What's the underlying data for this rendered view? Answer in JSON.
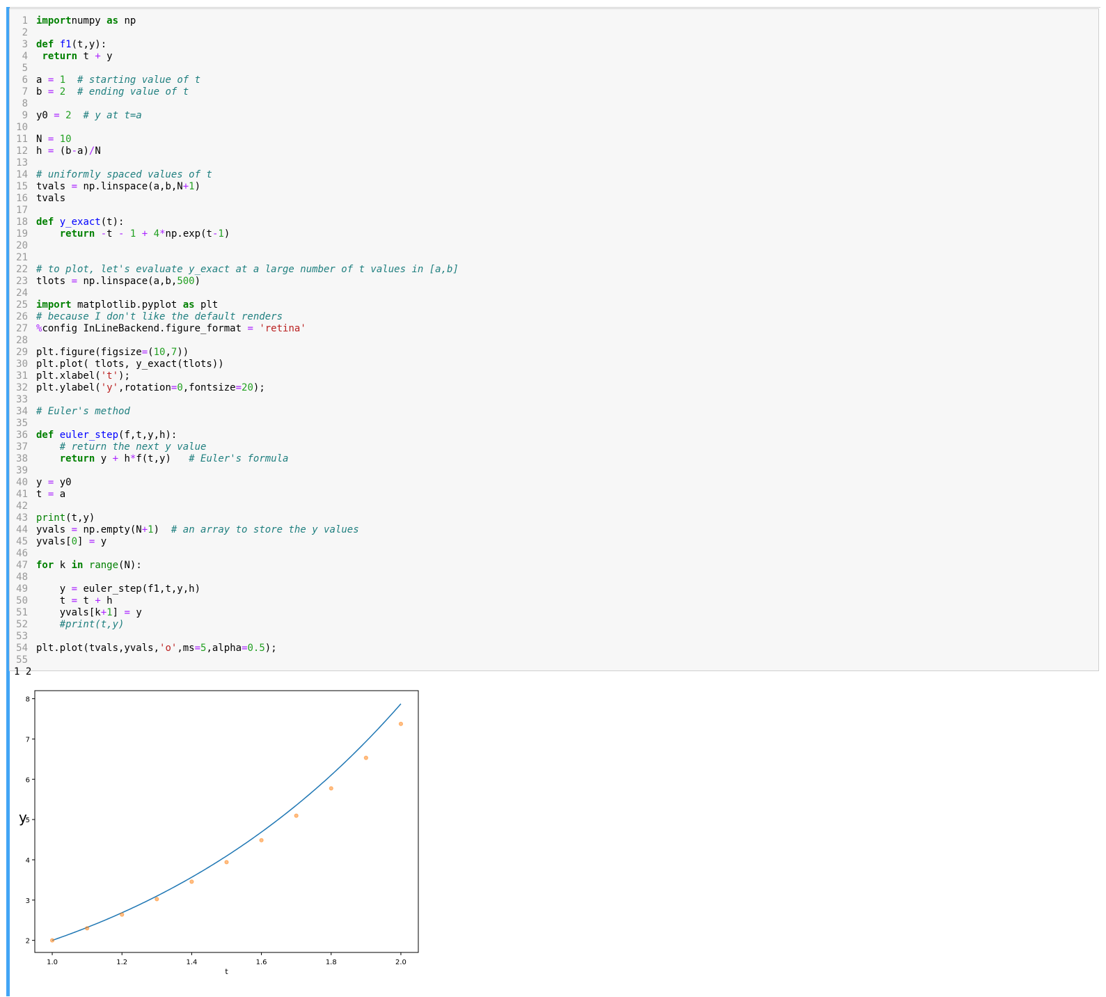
{
  "code_lines": [
    [
      [
        "kw",
        "import"
      ],
      [
        "",
        "numpy "
      ],
      [
        "kw",
        "as"
      ],
      [
        "",
        " np"
      ]
    ],
    [],
    [
      [
        "kw",
        "def"
      ],
      [
        "",
        " "
      ],
      [
        "fn",
        "f1"
      ],
      [
        "",
        "(t,y):"
      ]
    ],
    [
      [
        "",
        " "
      ],
      [
        "kw",
        "return"
      ],
      [
        "",
        " t "
      ],
      [
        "op",
        "+"
      ],
      [
        "",
        " y"
      ]
    ],
    [],
    [
      [
        "",
        "a "
      ],
      [
        "op",
        "="
      ],
      [
        "",
        " "
      ],
      [
        "num",
        "1"
      ],
      [
        "",
        "  "
      ],
      [
        "cm",
        "# starting value of t"
      ]
    ],
    [
      [
        "",
        "b "
      ],
      [
        "op",
        "="
      ],
      [
        "",
        " "
      ],
      [
        "num",
        "2"
      ],
      [
        "",
        "  "
      ],
      [
        "cm",
        "# ending value of t"
      ]
    ],
    [],
    [
      [
        "",
        "y0 "
      ],
      [
        "op",
        "="
      ],
      [
        "",
        " "
      ],
      [
        "num",
        "2"
      ],
      [
        "",
        "  "
      ],
      [
        "cm",
        "# y at t=a"
      ]
    ],
    [],
    [
      [
        "",
        "N "
      ],
      [
        "op",
        "="
      ],
      [
        "",
        " "
      ],
      [
        "num",
        "10"
      ]
    ],
    [
      [
        "",
        "h "
      ],
      [
        "op",
        "="
      ],
      [
        "",
        " (b"
      ],
      [
        "op",
        "-"
      ],
      [
        "",
        "a)"
      ],
      [
        "op",
        "/"
      ],
      [
        "",
        "N"
      ]
    ],
    [],
    [
      [
        "cm",
        "# uniformly spaced values of t"
      ]
    ],
    [
      [
        "",
        "tvals "
      ],
      [
        "op",
        "="
      ],
      [
        "",
        " np.linspace(a,b,N"
      ],
      [
        "op",
        "+"
      ],
      [
        "num",
        "1"
      ],
      [
        "",
        ")"
      ]
    ],
    [
      [
        "",
        "tvals"
      ]
    ],
    [],
    [
      [
        "kw",
        "def"
      ],
      [
        "",
        " "
      ],
      [
        "fn",
        "y_exact"
      ],
      [
        "",
        "(t):"
      ]
    ],
    [
      [
        "",
        "    "
      ],
      [
        "kw",
        "return"
      ],
      [
        "",
        " "
      ],
      [
        "op",
        "-"
      ],
      [
        "",
        "t "
      ],
      [
        "op",
        "-"
      ],
      [
        "",
        " "
      ],
      [
        "num",
        "1"
      ],
      [
        "",
        " "
      ],
      [
        "op",
        "+"
      ],
      [
        "",
        " "
      ],
      [
        "num",
        "4"
      ],
      [
        "op",
        "*"
      ],
      [
        "",
        "np.exp(t"
      ],
      [
        "op",
        "-"
      ],
      [
        "num",
        "1"
      ],
      [
        "",
        ")"
      ]
    ],
    [],
    [],
    [
      [
        "cm",
        "# to plot, let's evaluate y_exact at a large number of t values in [a,b]"
      ]
    ],
    [
      [
        "",
        "tlots "
      ],
      [
        "op",
        "="
      ],
      [
        "",
        " np.linspace(a,b,"
      ],
      [
        "num",
        "500"
      ],
      [
        "",
        ")"
      ]
    ],
    [],
    [
      [
        "kw",
        "import"
      ],
      [
        "",
        " matplotlib.pyplot "
      ],
      [
        "kw",
        "as"
      ],
      [
        "",
        " plt"
      ]
    ],
    [
      [
        "cm",
        "# because I don't like the default renders"
      ]
    ],
    [
      [
        "op",
        "%"
      ],
      [
        "",
        "config InLineBackend.figure_format "
      ],
      [
        "op",
        "="
      ],
      [
        "",
        " "
      ],
      [
        "st",
        "'retina'"
      ]
    ],
    [],
    [
      [
        "",
        "plt.figure(figsize"
      ],
      [
        "op",
        "="
      ],
      [
        "",
        "("
      ],
      [
        "num",
        "10"
      ],
      [
        "",
        ","
      ],
      [
        "num",
        "7"
      ],
      [
        "",
        "))"
      ]
    ],
    [
      [
        "",
        "plt.plot( tlots, y_exact(tlots))"
      ]
    ],
    [
      [
        "",
        "plt.xlabel("
      ],
      [
        "st",
        "'t'"
      ],
      [
        "",
        ");"
      ]
    ],
    [
      [
        "",
        "plt.ylabel("
      ],
      [
        "st",
        "'y'"
      ],
      [
        "",
        ",rotation"
      ],
      [
        "op",
        "="
      ],
      [
        "num",
        "0"
      ],
      [
        "",
        ",fontsize"
      ],
      [
        "op",
        "="
      ],
      [
        "num",
        "20"
      ],
      [
        "",
        ");"
      ]
    ],
    [],
    [
      [
        "cm",
        "# Euler's method"
      ]
    ],
    [],
    [
      [
        "kw",
        "def"
      ],
      [
        "",
        " "
      ],
      [
        "fn",
        "euler_step"
      ],
      [
        "",
        "(f,t,y,h):"
      ]
    ],
    [
      [
        "",
        "    "
      ],
      [
        "cm",
        "# return the next y value"
      ]
    ],
    [
      [
        "",
        "    "
      ],
      [
        "kw",
        "return"
      ],
      [
        "",
        " y "
      ],
      [
        "op",
        "+"
      ],
      [
        "",
        " h"
      ],
      [
        "op",
        "*"
      ],
      [
        "",
        "f(t,y)   "
      ],
      [
        "cm",
        "# Euler's formula"
      ]
    ],
    [],
    [
      [
        "",
        "y "
      ],
      [
        "op",
        "="
      ],
      [
        "",
        " y0"
      ]
    ],
    [
      [
        "",
        "t "
      ],
      [
        "op",
        "="
      ],
      [
        "",
        " a"
      ]
    ],
    [],
    [
      [
        "bi",
        "print"
      ],
      [
        "",
        "(t,y)"
      ]
    ],
    [
      [
        "",
        "yvals "
      ],
      [
        "op",
        "="
      ],
      [
        "",
        " np.empty(N"
      ],
      [
        "op",
        "+"
      ],
      [
        "num",
        "1"
      ],
      [
        "",
        ")  "
      ],
      [
        "cm",
        "# an array to store the y values"
      ]
    ],
    [
      [
        "",
        "yvals["
      ],
      [
        "num",
        "0"
      ],
      [
        "",
        "] "
      ],
      [
        "op",
        "="
      ],
      [
        "",
        " y"
      ]
    ],
    [],
    [
      [
        "kw",
        "for"
      ],
      [
        "",
        " k "
      ],
      [
        "kw",
        "in"
      ],
      [
        "",
        " "
      ],
      [
        "bi",
        "range"
      ],
      [
        "",
        "(N):"
      ]
    ],
    [],
    [
      [
        "",
        "    y "
      ],
      [
        "op",
        "="
      ],
      [
        "",
        " euler_step(f1,t,y,h)"
      ]
    ],
    [
      [
        "",
        "    t "
      ],
      [
        "op",
        "="
      ],
      [
        "",
        " t "
      ],
      [
        "op",
        "+"
      ],
      [
        "",
        " h"
      ]
    ],
    [
      [
        "",
        "    yvals[k"
      ],
      [
        "op",
        "+"
      ],
      [
        "num",
        "1"
      ],
      [
        "",
        "] "
      ],
      [
        "op",
        "="
      ],
      [
        "",
        " y"
      ]
    ],
    [
      [
        "",
        "    "
      ],
      [
        "cm",
        "#print(t,y)"
      ]
    ],
    [],
    [
      [
        "",
        "plt.plot(tvals,yvals,"
      ],
      [
        "st",
        "'o'"
      ],
      [
        "",
        ",ms"
      ],
      [
        "op",
        "="
      ],
      [
        "num",
        "5"
      ],
      [
        "",
        ",alpha"
      ],
      [
        "op",
        "="
      ],
      [
        "num",
        "0.5"
      ],
      [
        "",
        ");"
      ]
    ],
    []
  ],
  "stdout": "1 2",
  "chart_data": {
    "type": "line",
    "xlabel": "t",
    "ylabel": "y",
    "xlim": [
      0.95,
      2.05
    ],
    "ylim": [
      1.7,
      8.2
    ],
    "xticks": [
      "1.0",
      "1.2",
      "1.4",
      "1.6",
      "1.8",
      "2.0"
    ],
    "yticks": [
      "2",
      "3",
      "4",
      "5",
      "6",
      "7",
      "8"
    ],
    "series": [
      {
        "kind": "line",
        "color": "#1f77b4",
        "function": "-t - 1 + 4*exp(t-1)",
        "x_range": [
          1.0,
          2.0
        ]
      },
      {
        "kind": "scatter",
        "color": "#ff7f0e",
        "alpha": 0.5,
        "x": [
          1.0,
          1.1,
          1.2,
          1.3,
          1.4,
          1.5,
          1.6,
          1.7,
          1.8,
          1.9,
          2.0
        ],
        "y": [
          2.0,
          2.3,
          2.64,
          3.024,
          3.4564,
          3.942,
          4.4862,
          5.0949,
          5.7743,
          6.5318,
          7.3749
        ]
      }
    ]
  }
}
